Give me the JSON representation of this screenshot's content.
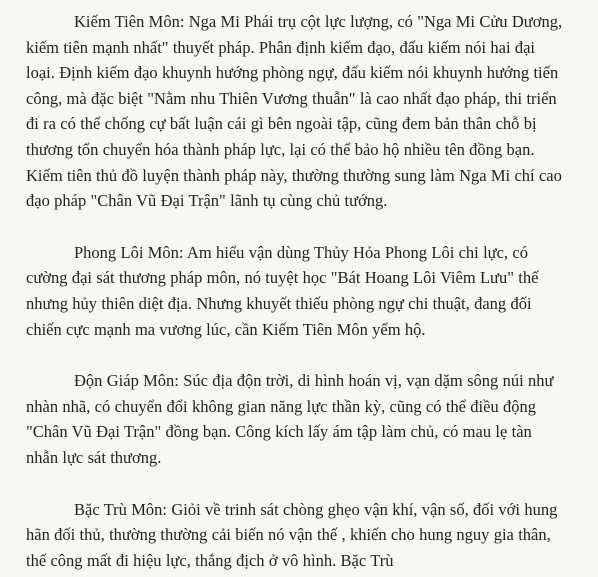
{
  "paragraphs": [
    "Kiếm Tiên Môn: Nga Mi Phái trụ cột lực lượng, có \"Nga Mi Cửu Dương, kiếm tiên mạnh nhất\" thuyết pháp. Phân định kiếm đạo, đấu kiếm nói hai đại loại. Định kiếm đạo khuynh hướng phòng ngự, đấu kiếm nói khuynh hướng tiến công, mà đặc biệt \"Nằm nhu Thiên Vương thuẫn\" là cao nhất đạo pháp, thi triển đi ra có thể chống cự bất luận cái gì bên ngoài tập, cũng đem bản thân chỗ bị thương tổn chuyển hóa thành pháp lực, lại có thể bảo hộ nhiều tên đồng bạn. Kiếm tiên thủ đồ luyện thành pháp này, thường thường sung làm Nga Mi chí cao đạo pháp \"Chân Vũ Đại Trận\" lãnh tụ cùng chủ tướng.",
    "Phong Lôi Môn: Am hiểu vận dùng Thủy Hỏa Phong Lôi chi lực, có cường đại sát thương pháp môn, nó tuyệt học \"Bát Hoang Lôi Viêm Lưu\" thế nhưng hủy thiên diệt địa. Nhưng khuyết thiếu phòng ngự chi thuật, đang đối chiến cực mạnh ma vương lúc, cần Kiếm Tiên Môn yểm hộ.",
    "Độn Giáp Môn: Súc địa độn trời, di hình hoán vị, vạn dặm sông núi như nhàn nhã, có chuyển đổi không gian năng lực thần kỳ, cũng có thể điều động \"Chân Vũ Đại Trận\" đồng bạn. Công kích lấy ám tập làm chủ, có mau lẹ tàn nhẫn lực sát thương.",
    "Bặc Trù Môn: Giỏi về trinh sát chòng ghẹo vận khí, vận số, đối với hung hãn đối thủ, thường thường cải biến nó vận thế , khiến cho hung nguy gia thân, thế công mất đi hiệu lực, thắng địch ở vô hình. Bặc Trù"
  ]
}
